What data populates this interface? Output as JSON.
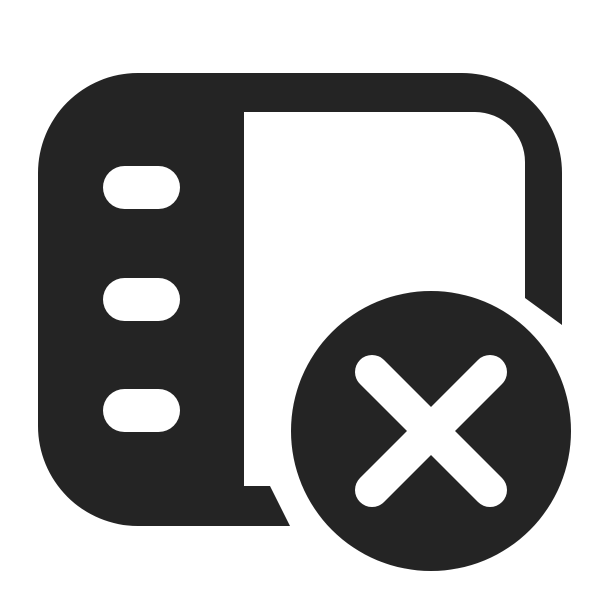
{
  "icon": {
    "name": "sidebar-layout-dismiss-icon",
    "parts": [
      "panel-frame",
      "sidebar-list-lines",
      "dismiss-badge"
    ]
  },
  "colors": {
    "foreground": "#242424",
    "background": "#ffffff",
    "cutout": "#ffffff"
  }
}
